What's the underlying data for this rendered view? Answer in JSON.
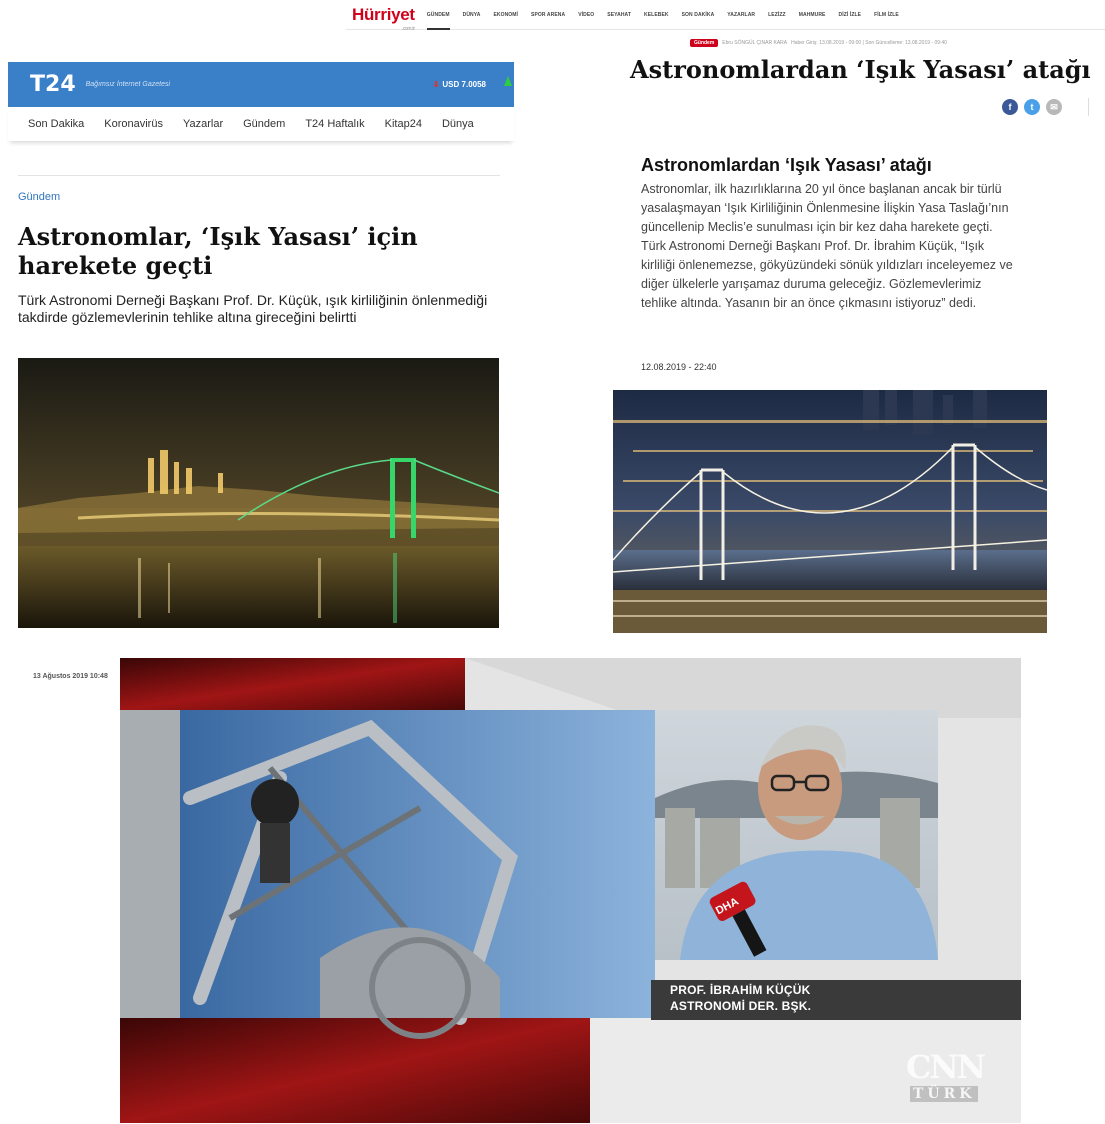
{
  "hurriyet": {
    "logo": "Hürriyet",
    "logo_sub": ".com.tr",
    "nav": [
      "GÜNDEM",
      "DÜNYA",
      "EKONOMİ",
      "SPOR ARENA",
      "VİDEO",
      "SEYAHAT",
      "KELEBEK",
      "SON DAKİKA",
      "YAZARLAR",
      "LEZİZZ",
      "MAHMURE",
      "DİZİ İZLE",
      "FİLM İZLE"
    ],
    "meta": {
      "badge": "Gündem",
      "author": "Ebru SÖNGÜL ÇINAR KARA",
      "dates": "Haber Giriş: 13.08.2019 - 09:00 | Son Güncelleme: 13.08.2019 - 09:40"
    },
    "headline": "Astronomlardan ‘Işık Yasası’ atağı",
    "card": {
      "title": "Astronomlardan ‘Işık Yasası’ atağı",
      "body": "Astronomlar, ilk hazırlıklarına 20 yıl önce başlanan ancak bir türlü yasalaşmayan ‘Işık Kirliliğinin Önlenmesine İlişkin Yasa Taslağı’nın güncellenip Meclis’e sunulması için bir kez daha harekete geçti. Türk Astronomi Derneği Başkanı Prof. Dr. İbrahim Küçük, “Işık kirliliği önlenemezse, gökyüzündeki sönük yıldızları inceleyemez ve diğer ülkelerle yarışamaz duruma geleceğiz. Gözlemevlerimiz tehlike altında. Yasanın bir an önce çıkmasını istiyoruz” dedi.",
      "date": "12.08.2019 - 22:40"
    }
  },
  "t24": {
    "logo": "T24",
    "tagline": "Bağımsız İnternet Gazetesi",
    "currency": "USD 7.0058",
    "nav": [
      "Son Dakika",
      "Koronavirüs",
      "Yazarlar",
      "Gündem",
      "T24 Haftalık",
      "Kitap24",
      "Dünya"
    ],
    "category": "Gündem",
    "title": "Astronomlar, ‘Işık Yasası’ için harekete geçti",
    "summary": "Türk Astronomi Derneği Başkanı Prof. Dr. Küçük, ışık kirliliğinin önlenmediği takdirde gözlemevlerinin tehlike altına gireceğini belirtti"
  },
  "cnn": {
    "date": "13 Ağustos 2019 10:48",
    "mic_label": "DHA",
    "name_line1": "PROF. İBRAHİM KÜÇÜK",
    "name_line2": "ASTRONOMİ DER. BŞK.",
    "logo_top": "CNN",
    "logo_bottom": "TÜRK"
  },
  "colors": {
    "hurriyet_red": "#d0021b",
    "t24_blue": "#3a80c8",
    "cnn_red": "#8b1212"
  }
}
